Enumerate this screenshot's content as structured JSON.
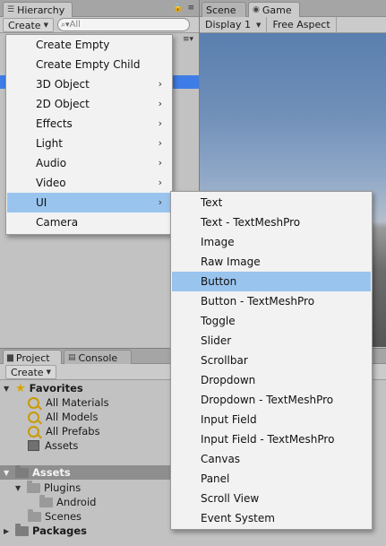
{
  "hierarchy": {
    "tab_label": "Hierarchy",
    "tab_tools": "🔒 ≡",
    "create_label": "Create",
    "search_placeholder": "All"
  },
  "scene_tab_label": "Scene",
  "game": {
    "tab_label": "Game",
    "display": "Display 1",
    "aspect": "Free Aspect"
  },
  "project": {
    "tab_label": "Project",
    "console_tab_label": "Console",
    "create_label": "Create",
    "tree": {
      "favorites": "Favorites",
      "all_materials": "All Materials",
      "all_models": "All Models",
      "all_prefabs": "All Prefabs",
      "fav_assets": "Assets",
      "assets": "Assets",
      "plugins": "Plugins",
      "android": "Android",
      "scenes": "Scenes",
      "packages": "Packages"
    }
  },
  "create_menu": {
    "items": [
      "Create Empty",
      "Create Empty Child",
      "3D Object",
      "2D Object",
      "Effects",
      "Light",
      "Audio",
      "Video",
      "UI",
      "Camera"
    ],
    "highlighted": "UI"
  },
  "ui_submenu": {
    "items": [
      "Text",
      "Text - TextMeshPro",
      "Image",
      "Raw Image",
      "Button",
      "Button - TextMeshPro",
      "Toggle",
      "Slider",
      "Scrollbar",
      "Dropdown",
      "Dropdown - TextMeshPro",
      "Input Field",
      "Input Field - TextMeshPro",
      "Canvas",
      "Panel",
      "Scroll View",
      "Event System"
    ],
    "highlighted": "Button"
  },
  "colors": {
    "menu_highlight": "#99c4ee",
    "selection_blue": "#3e7de7"
  }
}
